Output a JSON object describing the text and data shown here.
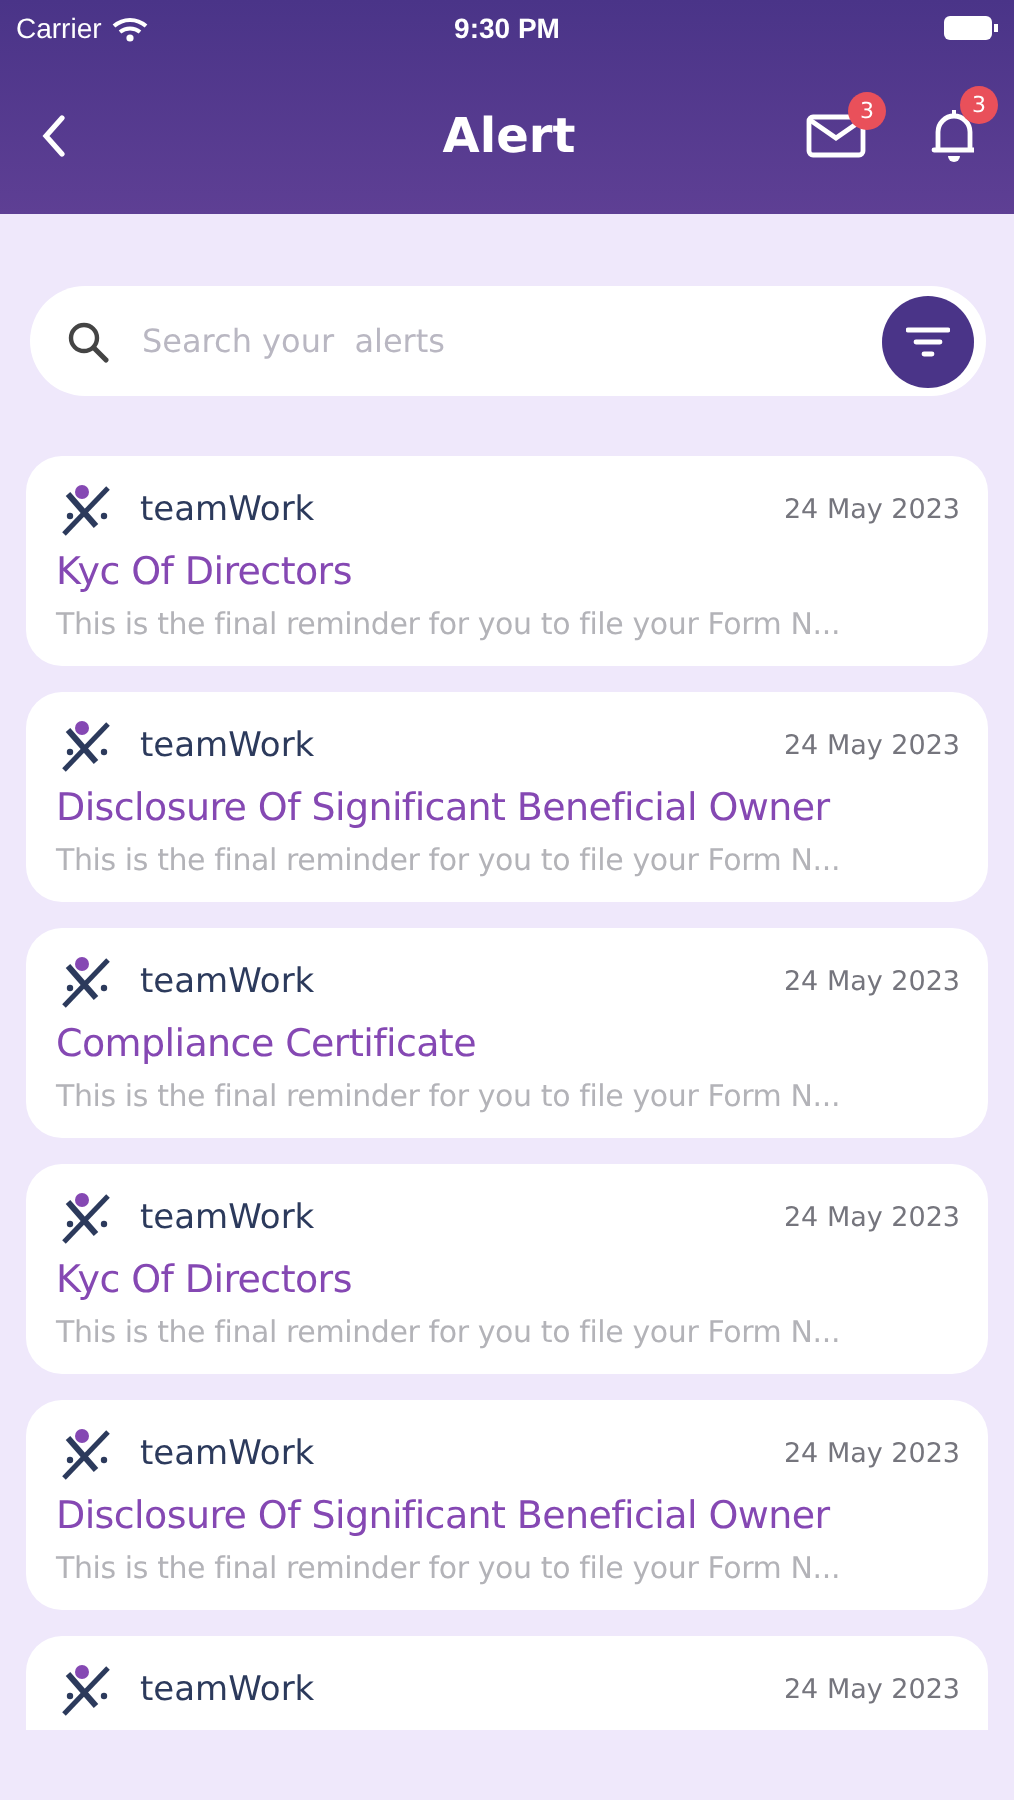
{
  "status_bar": {
    "carrier": "Carrier",
    "time": "9:30 PM"
  },
  "header": {
    "title": "Alert",
    "mail_badge": "3",
    "bell_badge": "3"
  },
  "search": {
    "placeholder": "Search your  alerts"
  },
  "alerts": [
    {
      "source": "teamWork",
      "date": "24 May 2023",
      "title": "Kyc Of Directors",
      "body": "This is the final reminder for you to file your Form N..."
    },
    {
      "source": "teamWork",
      "date": "24 May 2023",
      "title": "Disclosure Of Significant Beneficial Owner",
      "body": "This is the final reminder for you to file your Form N..."
    },
    {
      "source": "teamWork",
      "date": "24 May 2023",
      "title": "Compliance Certificate",
      "body": "This is the final reminder for you to file your Form N..."
    },
    {
      "source": "teamWork",
      "date": "24 May 2023",
      "title": "Kyc Of Directors",
      "body": "This is the final reminder for you to file your Form N..."
    },
    {
      "source": "teamWork",
      "date": "24 May 2023",
      "title": "Disclosure Of Significant Beneficial Owner",
      "body": "This is the final reminder for you to file your Form N..."
    },
    {
      "source": "teamWork",
      "date": "24 May 2023"
    }
  ]
}
